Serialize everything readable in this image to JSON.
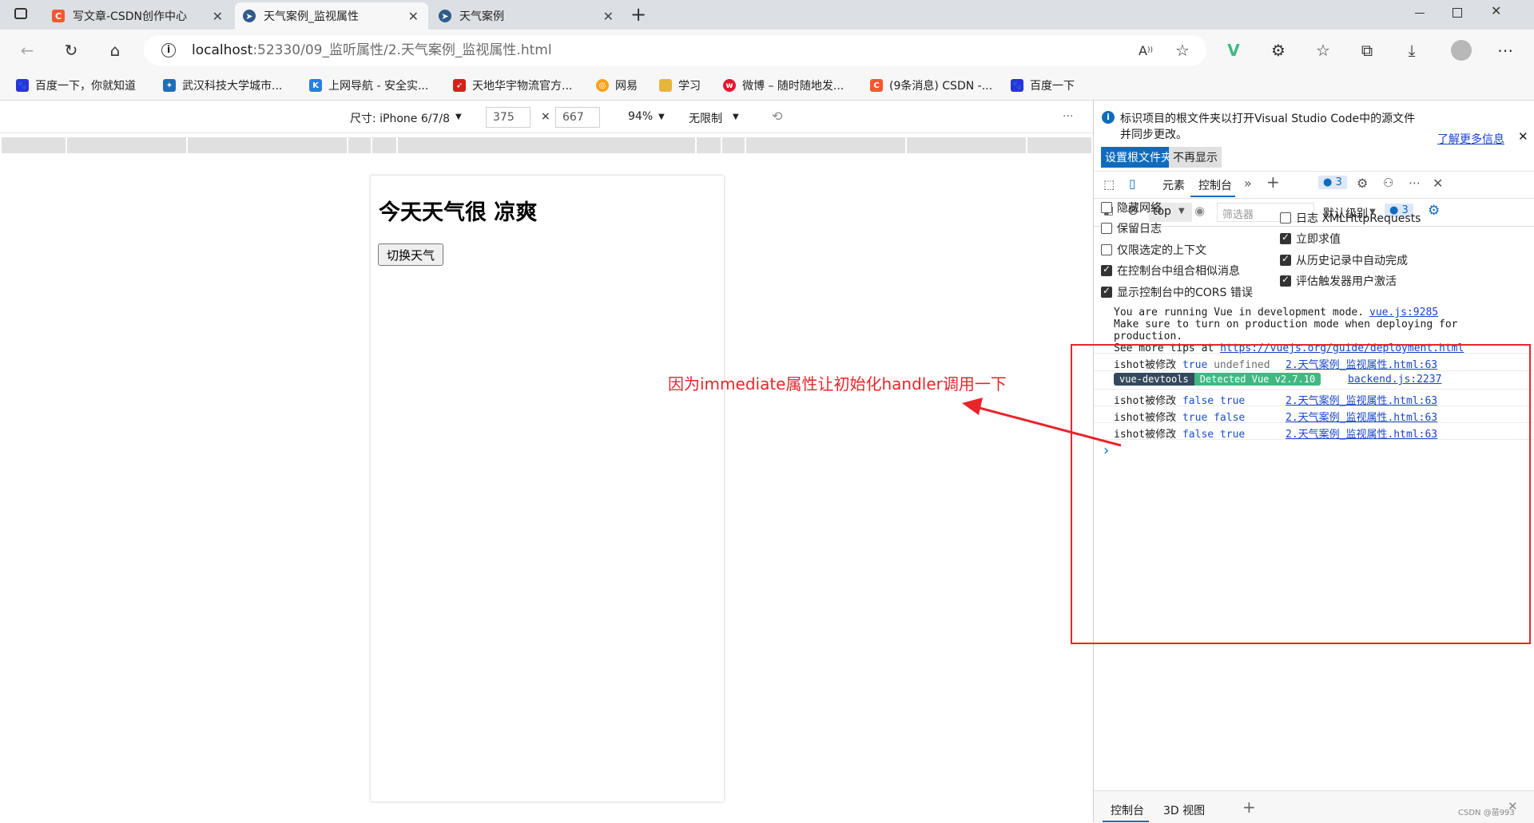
{
  "tabs": [
    {
      "title": "写文章-CSDN创作中心",
      "icon": "csdn-icon",
      "color": "#fc5531",
      "active": false
    },
    {
      "title": "天气案例_监视属性",
      "icon": "page-icon",
      "color": "#2f5d8a",
      "active": true
    },
    {
      "title": "天气案例",
      "icon": "page-icon",
      "color": "#2f5d8a",
      "active": false
    }
  ],
  "address": {
    "host": "localhost",
    "rest": ":52330/09_监听属性/2.天气案例_监视属性.html"
  },
  "bookmarks": [
    {
      "label": "百度一下，你就知道",
      "icon": "baidu-icon",
      "color": "#2932e1"
    },
    {
      "label": "武汉科技大学城市...",
      "icon": "university-icon",
      "color": "#1e6fb8"
    },
    {
      "label": "上网导航 - 安全实...",
      "icon": "shield-icon",
      "color": "#2a7de1"
    },
    {
      "label": "天地华宇物流官方...",
      "icon": "logistics-icon",
      "color": "#d6201a"
    },
    {
      "label": "网易",
      "icon": "netease-icon",
      "color": "#f6a21b"
    },
    {
      "label": "学习",
      "icon": "folder-icon",
      "color": "#e8b53b"
    },
    {
      "label": "微博 – 随时随地发...",
      "icon": "weibo-icon",
      "color": "#e6162d"
    },
    {
      "label": "(9条消息) CSDN -...",
      "icon": "csdn-icon",
      "color": "#fc5531"
    },
    {
      "label": "百度一下",
      "icon": "baidu-icon",
      "color": "#2932e1"
    }
  ],
  "device_toolbar": {
    "device": "尺寸: iPhone 6/7/8",
    "width": "375",
    "times": "×",
    "height": "667",
    "zoom": "94%",
    "throttle": "无限制",
    "more": "···"
  },
  "page": {
    "heading": "今天天气很 凉爽",
    "button": "切换天气"
  },
  "devtools": {
    "info_line1": "标识项目的根文件夹以打开Visual Studio Code中的源文件",
    "info_line2": "并同步更改。",
    "learn_more": "了解更多信息",
    "set_root": "设置根文件夹",
    "dont_show": "不再显示",
    "tab_elements": "元素",
    "tab_console": "控制台",
    "badge_count": "3",
    "context": "top",
    "filter_placeholder": "筛选器",
    "levels": "默认级别",
    "levels_badge": "3",
    "settings_left": [
      {
        "label": "隐藏网络",
        "checked": false
      },
      {
        "label": "保留日志",
        "checked": false
      },
      {
        "label": "仅限选定的上下文",
        "checked": false
      },
      {
        "label": "在控制台中组合相似消息",
        "checked": true
      },
      {
        "label": "显示控制台中的CORS 错误",
        "checked": true
      }
    ],
    "settings_right": [
      {
        "label": "日志 XMLHttpRequests",
        "checked": false
      },
      {
        "label": "立即求值",
        "checked": true
      },
      {
        "label": "从历史记录中自动完成",
        "checked": true
      },
      {
        "label": "评估触发器用户激活",
        "checked": true
      }
    ],
    "console": {
      "vue_msg1": "You are running Vue in development mode.",
      "vue_msg2": "Make sure to turn on production mode when deploying for",
      "vue_msg3": "production.",
      "vue_msg4_prefix": "See more tips at ",
      "vue_msg4_link": "https://vuejs.org/guide/deployment.html",
      "vue_source": "vue.js:9285",
      "log_source": "2.天气案例_监视属性.html:63",
      "devtools_badge_left": "vue-devtools",
      "devtools_badge_right": "Detected Vue v2.7.10",
      "devtools_source": "backend.js:2237",
      "logs": [
        {
          "prefix": "ishot被修改",
          "a": "true",
          "b": "undefined"
        },
        {
          "prefix": "ishot被修改",
          "a": "false",
          "b": "true"
        },
        {
          "prefix": "ishot被修改",
          "a": "true",
          "b": "false"
        },
        {
          "prefix": "ishot被修改",
          "a": "false",
          "b": "true"
        }
      ],
      "prompt": "›"
    },
    "drawer_console": "控制台",
    "drawer_3d": "3D 视图",
    "watermark": "CSDN @苗993"
  },
  "annotation": "因为immediate属性让初始化handler调用一下",
  "colors": {
    "annotation": "#e8252b",
    "accent": "#0f6cbd",
    "vue_green": "#41b883",
    "vue_dark": "#35495e"
  }
}
